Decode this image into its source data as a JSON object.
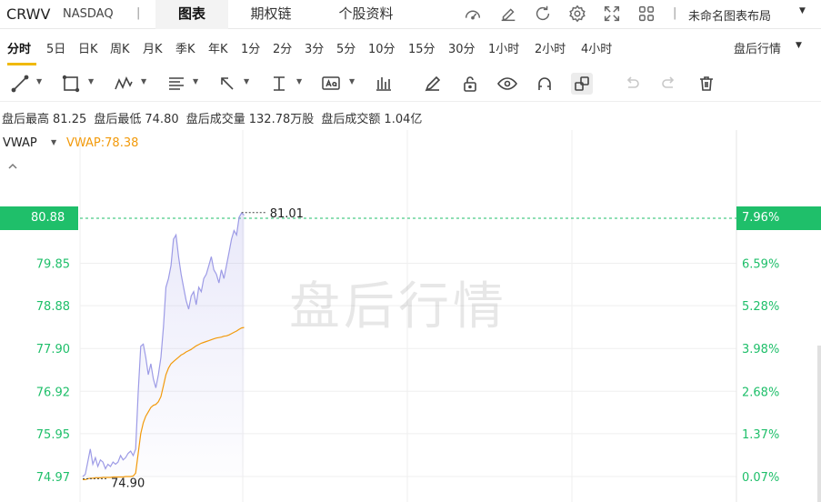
{
  "header": {
    "ticker": "CRWV",
    "exchange": "NASDAQ",
    "separator": "|",
    "tabs": [
      "图表",
      "期权链",
      "个股资料"
    ],
    "layout_separator": "|",
    "layout_name": "未命名图表布局",
    "icons": [
      "gauge-icon",
      "edit-icon",
      "refresh-icon",
      "settings-icon",
      "fullscreen-icon",
      "grid-icon"
    ]
  },
  "periods": {
    "items": [
      "分时",
      "5日",
      "日K",
      "周K",
      "月K",
      "季K",
      "年K",
      "1分",
      "2分",
      "3分",
      "5分",
      "10分",
      "15分",
      "30分",
      "1小时",
      "2小时",
      "4小时"
    ],
    "active": "分时",
    "session_select": "盘后行情"
  },
  "stats": {
    "high_label": "盘后最高",
    "high_value": "81.25",
    "low_label": "盘后最低",
    "low_value": "74.80",
    "volume_label": "盘后成交量",
    "volume_value": "132.78万股",
    "amount_label": "盘后成交额",
    "amount_value": "1.04亿"
  },
  "indicator": {
    "name": "VWAP",
    "value_text": "VWAP:78.38"
  },
  "chart": {
    "watermark": "盘后行情",
    "last_price": "80.88",
    "last_pct": "7.96%",
    "colors": {
      "price_line": "#9d9be6",
      "vwap_line": "#f29a0b",
      "up": "#1fbf6a",
      "grid": "#efefef"
    }
  },
  "chart_data": {
    "type": "line",
    "y_ticks": [
      "80.88",
      "79.85",
      "78.88",
      "77.90",
      "76.92",
      "75.95",
      "74.97"
    ],
    "y_tick_values": [
      80.88,
      79.85,
      78.88,
      77.9,
      76.92,
      75.95,
      74.97
    ],
    "pct_ticks": [
      "7.96%",
      "6.59%",
      "5.28%",
      "3.98%",
      "2.68%",
      "1.37%",
      "0.07%"
    ],
    "ylim": [
      74.97,
      80.88
    ],
    "high_annotation": "81.01",
    "high_value": 81.01,
    "low_annotation": "74.90",
    "low_value": 74.9,
    "session_fraction_elapsed": 0.25,
    "series": [
      {
        "name": "",
        "values": [
          74.97,
          75.02,
          75.3,
          75.6,
          75.25,
          75.4,
          75.2,
          75.35,
          75.3,
          75.15,
          75.25,
          75.2,
          75.3,
          75.25,
          75.3,
          75.45,
          75.35,
          75.4,
          75.5,
          75.55,
          75.45,
          75.6,
          76.9,
          77.95,
          78.0,
          77.7,
          77.3,
          77.55,
          77.2,
          77.0,
          77.3,
          77.7,
          78.4,
          79.3,
          79.5,
          79.8,
          80.4,
          80.5,
          80.0,
          79.6,
          79.3,
          79.0,
          78.8,
          79.1,
          79.2,
          78.9,
          79.3,
          79.2,
          79.5,
          79.6,
          79.8,
          80.0,
          79.7,
          79.6,
          79.4,
          79.7,
          79.5,
          79.8,
          80.1,
          80.4,
          80.6,
          80.5,
          80.9,
          81.0,
          80.95
        ]
      },
      {
        "name": "",
        "values": [
          74.9,
          74.9,
          74.92,
          74.93,
          74.93,
          74.94,
          74.94,
          74.94,
          74.95,
          74.95,
          74.95,
          74.95,
          74.96,
          74.96,
          74.96,
          74.96,
          74.96,
          74.97,
          74.97,
          74.97,
          74.98,
          75.05,
          75.5,
          75.95,
          76.2,
          76.35,
          76.45,
          76.55,
          76.6,
          76.62,
          76.68,
          76.8,
          77.05,
          77.3,
          77.45,
          77.55,
          77.6,
          77.65,
          77.7,
          77.75,
          77.78,
          77.82,
          77.85,
          77.88,
          77.92,
          77.96,
          77.99,
          78.02,
          78.04,
          78.06,
          78.08,
          78.1,
          78.12,
          78.14,
          78.15,
          78.16,
          78.18,
          78.19,
          78.21,
          78.24,
          78.27,
          78.3,
          78.34,
          78.37,
          78.38
        ]
      }
    ]
  }
}
